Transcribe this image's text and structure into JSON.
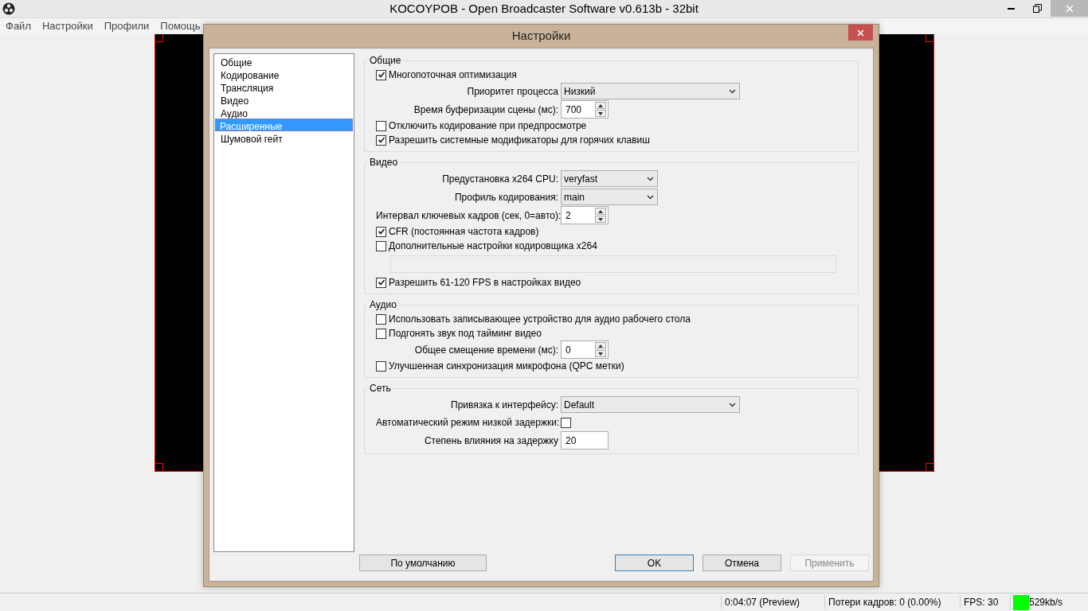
{
  "app": {
    "title": "KOCOYPOB - Open Broadcaster Software v0.613b - 32bit",
    "menu": [
      "Файл",
      "Настройки",
      "Профили",
      "Помощь"
    ]
  },
  "dialog": {
    "title": "Настройки",
    "nav": [
      {
        "label": "Общие",
        "selected": false
      },
      {
        "label": "Кодирование",
        "selected": false
      },
      {
        "label": "Трансляция",
        "selected": false
      },
      {
        "label": "Видео",
        "selected": false
      },
      {
        "label": "Аудио",
        "selected": false
      },
      {
        "label": "Расширенные",
        "selected": true
      },
      {
        "label": "Шумовой гейт",
        "selected": false
      }
    ],
    "groups": [
      {
        "title": "Общие",
        "items": [
          {
            "kind": "check",
            "label": "Многопоточная оптимизация",
            "checked": true
          },
          {
            "kind": "select",
            "label": "Приоритет процесса",
            "value": "Низкий"
          },
          {
            "kind": "spin",
            "label": "Время буферизации сцены (мс):",
            "value": "700"
          },
          {
            "kind": "check",
            "label": "Отключить кодирование при предпросмотре",
            "checked": false
          },
          {
            "kind": "check",
            "label": "Разрешить системные модификаторы для горячих клавиш",
            "checked": true
          }
        ]
      },
      {
        "title": "Видео",
        "items": [
          {
            "kind": "select",
            "label": "Предустановка x264 CPU:",
            "value": "veryfast"
          },
          {
            "kind": "select",
            "label": "Профиль кодирования:",
            "value": "main"
          },
          {
            "kind": "spin",
            "label": "Интервал ключевых кадров (сек, 0=авто):",
            "value": "2"
          },
          {
            "kind": "check",
            "label": "CFR (постоянная частота кадров)",
            "checked": true
          },
          {
            "kind": "check",
            "label": "Дополнительные настройки кодировщика x264",
            "checked": false
          },
          {
            "kind": "blank"
          },
          {
            "kind": "check",
            "label": "Разрешить 61-120 FPS в настройках видео",
            "checked": true
          }
        ]
      },
      {
        "title": "Аудио",
        "items": [
          {
            "kind": "check",
            "label": "Использовать записывающее устройство для аудио рабочего стола",
            "checked": false
          },
          {
            "kind": "check",
            "label": "Подгонять звук под тайминг видео",
            "checked": false
          },
          {
            "kind": "spin",
            "label": "Общее смещение времени (мс):",
            "value": "0"
          },
          {
            "kind": "check",
            "label": "Улучшенная синхронизация микрофона (QPC метки)",
            "checked": false
          }
        ]
      },
      {
        "title": "Сеть",
        "items": [
          {
            "kind": "select",
            "label": "Привязка к интерфейсу:",
            "value": "Default"
          },
          {
            "kind": "checkright",
            "label": "Автоматический режим низкой задержки:",
            "checked": false
          },
          {
            "kind": "field",
            "label": "Степень влияния на задержку",
            "value": "20"
          }
        ]
      }
    ],
    "buttons": [
      {
        "label": "По умолчанию",
        "kind": "normal"
      },
      {
        "label": "OK",
        "kind": "default"
      },
      {
        "label": "Отмена",
        "kind": "normal"
      },
      {
        "label": "Применить",
        "kind": "disabled"
      }
    ]
  },
  "status_bar": {
    "time": "0:04:07 (Preview)",
    "dropped": "Потери кадров: 0 (0.00%)",
    "fps": "FPS: 30",
    "bitrate": "529kb/s"
  }
}
